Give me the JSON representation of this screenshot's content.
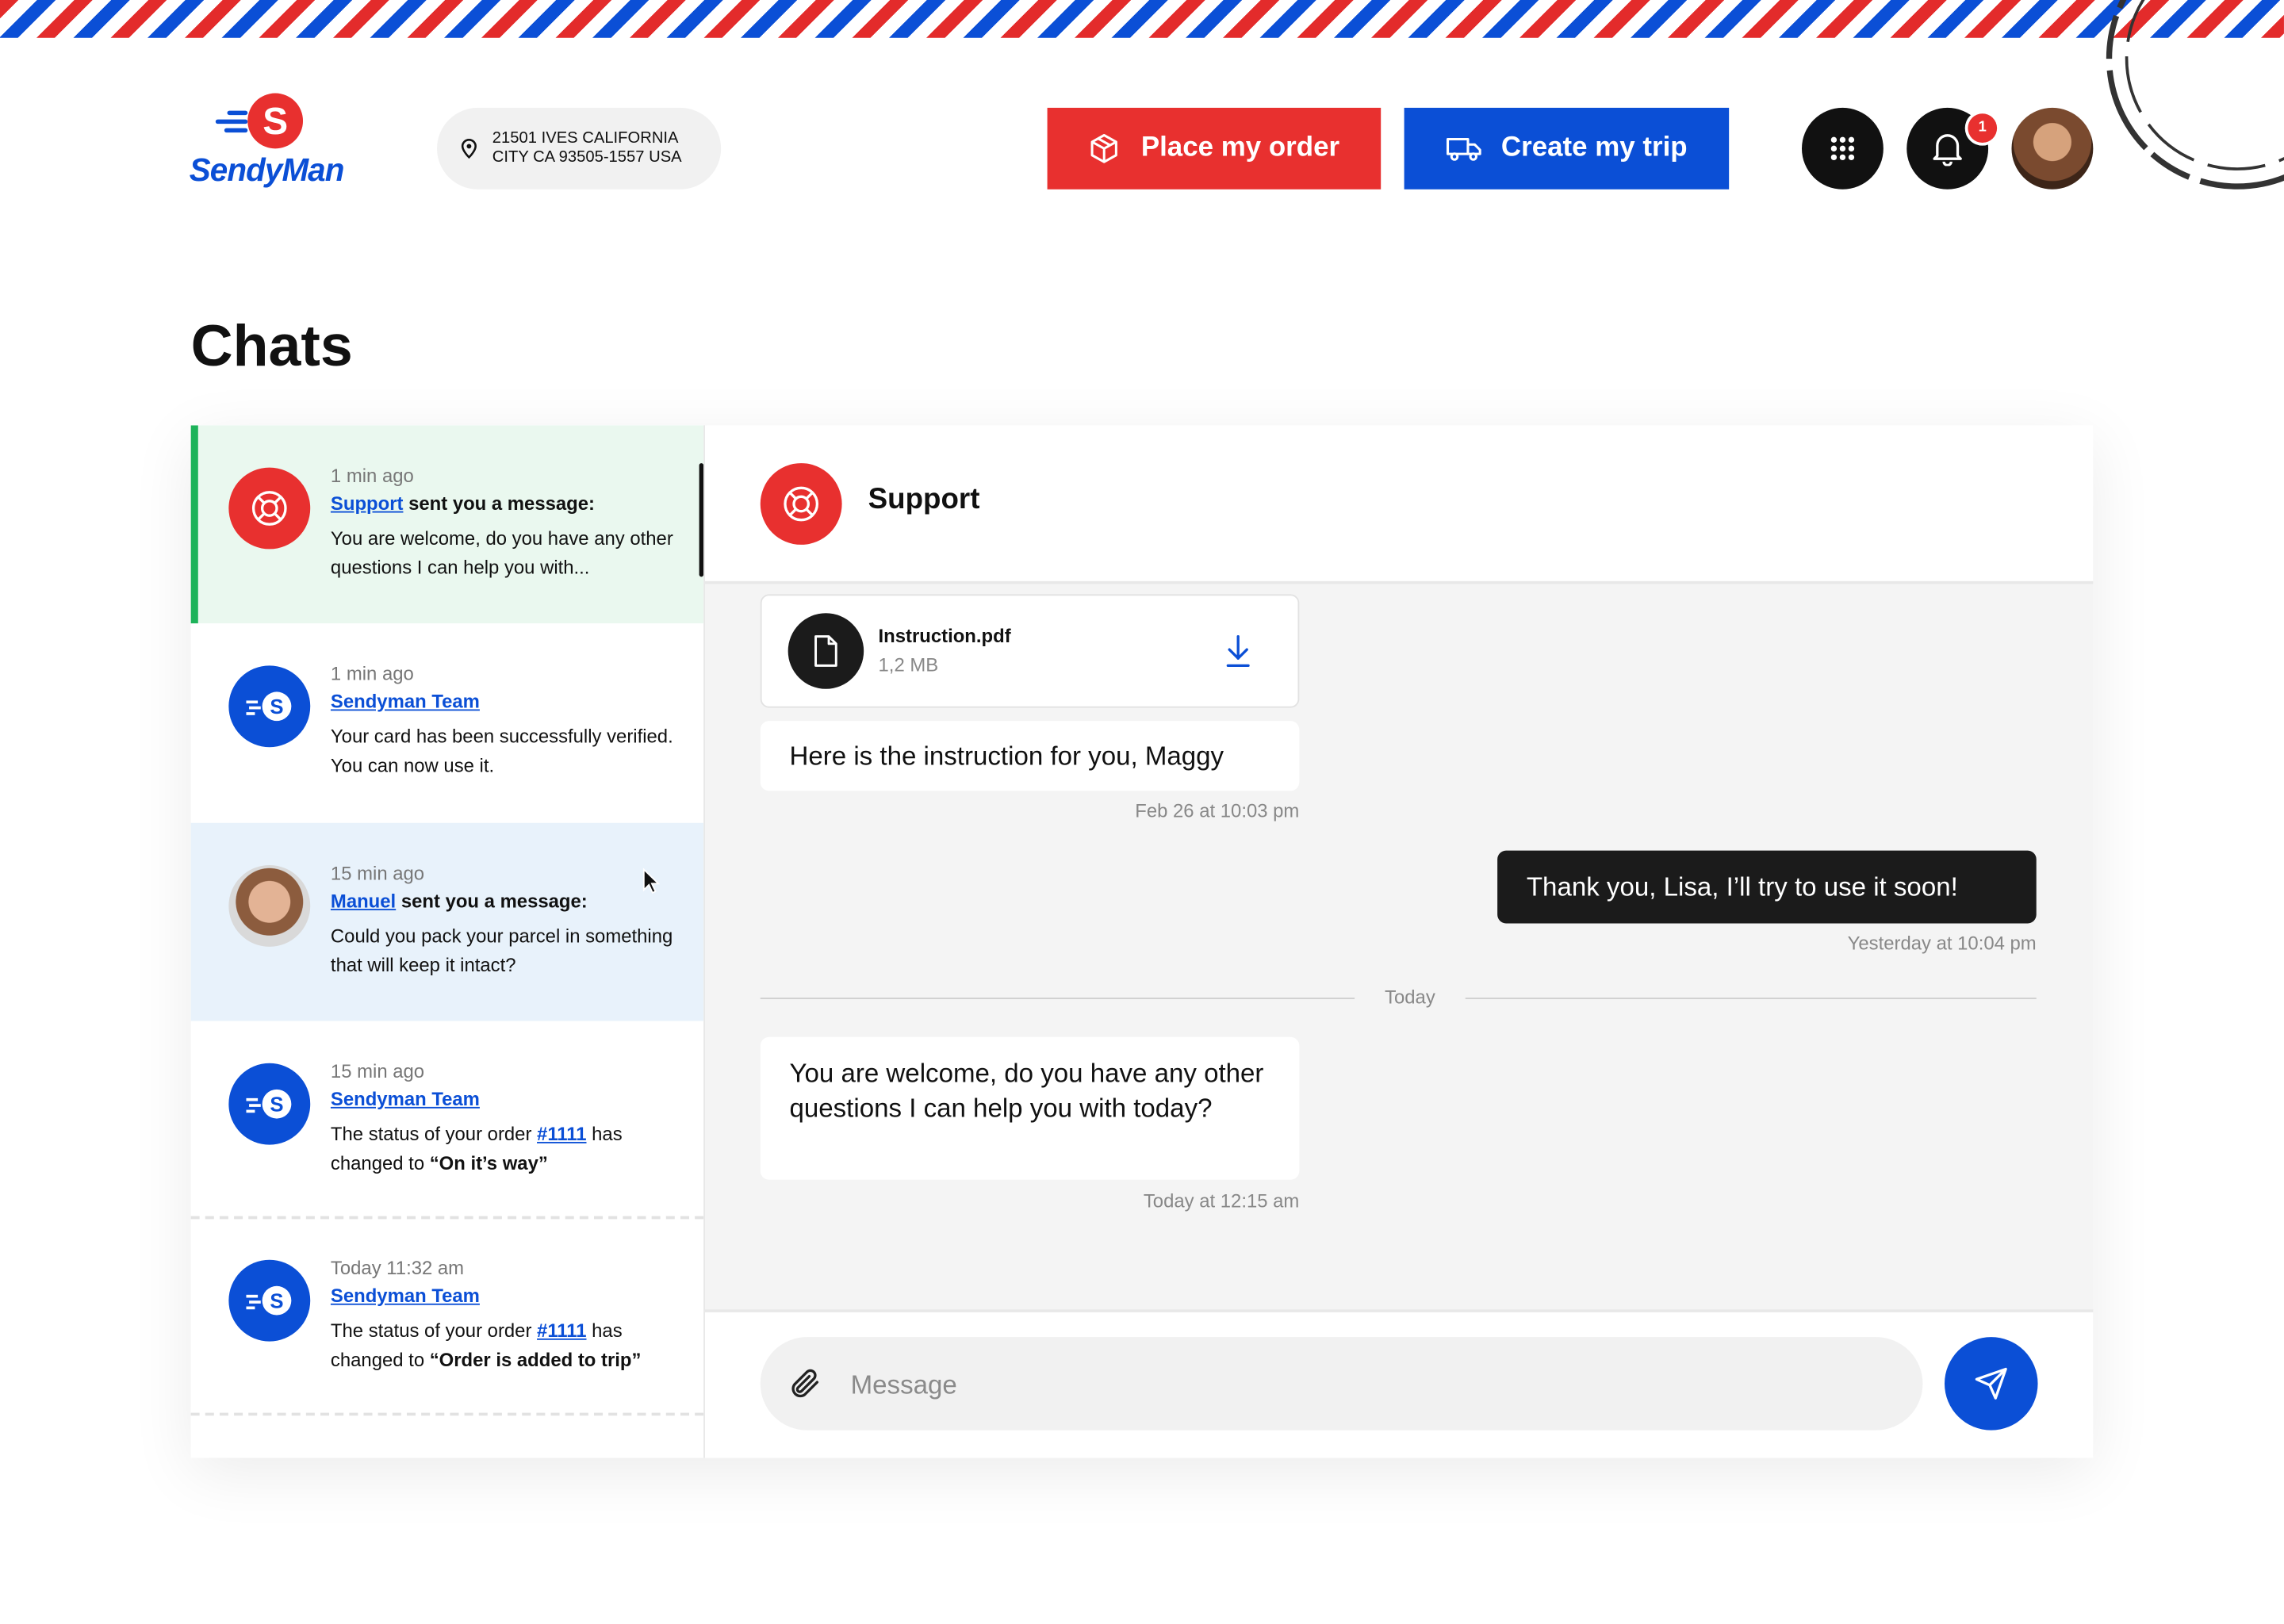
{
  "brand": {
    "name": "SendyMan",
    "badge_letter": "S",
    "colors": {
      "red": "#e8302f",
      "blue": "#0b4fd6",
      "green": "#1db35a"
    }
  },
  "header": {
    "address_line1": "21501 IVES CALIFORNIA",
    "address_line2": "CITY CA 93505-1557 USA",
    "place_order_label": "Place my order",
    "create_trip_label": "Create my trip",
    "notifications_count": "1",
    "icons": [
      "location-pin-icon",
      "package-icon",
      "truck-icon",
      "grid-icon",
      "bell-icon"
    ]
  },
  "page": {
    "title": "Chats"
  },
  "conversations": [
    {
      "time": "1 min ago",
      "sender": "Support",
      "suffix": " sent you a message:",
      "text": "You are welcome, do you have any other questions I can help you with...",
      "avatar": "lifebuoy-icon",
      "state": "active"
    },
    {
      "time": "1 min ago",
      "sender": "Sendyman Team",
      "suffix": "",
      "text": "Your card has been successfully verified. You can now use it.",
      "avatar": "sendyman-logo-icon",
      "state": "default"
    },
    {
      "time": "15 min ago",
      "sender": "Manuel",
      "suffix": " sent you a message:",
      "text": "Could you pack your parcel in something that will keep it intact?",
      "avatar": "user-photo",
      "state": "hover"
    },
    {
      "time": "15 min ago",
      "sender": "Sendyman Team",
      "suffix": "",
      "text_before": "The status of your order ",
      "order_link": "#1111",
      "text_mid": " has changed to ",
      "status": "“On it’s way”",
      "avatar": "sendyman-logo-icon",
      "state": "default"
    },
    {
      "time": "Today 11:32 am",
      "sender": "Sendyman Team",
      "suffix": "",
      "text_before": "The status of your order ",
      "order_link": "#1111",
      "text_mid": " has changed to ",
      "status": "“Order is added to trip”",
      "avatar": "sendyman-logo-icon",
      "state": "default"
    }
  ],
  "chat": {
    "contact_name": "Support",
    "file": {
      "name": "Instruction.pdf",
      "size": "1,2 MB"
    },
    "messages": [
      {
        "direction": "in",
        "text": "Here is the instruction for you, Maggy",
        "time": "Feb 26 at 10:03 pm"
      },
      {
        "direction": "out",
        "text": "Thank you, Lisa, I’ll try to use it soon!",
        "time": "Yesterday at 10:04 pm"
      },
      {
        "direction": "in",
        "text": "You are welcome, do you have any other questions I can help you with today?",
        "time": "Today at 12:15 am"
      }
    ],
    "day_divider": "Today",
    "composer": {
      "placeholder": "Message",
      "value": ""
    }
  }
}
